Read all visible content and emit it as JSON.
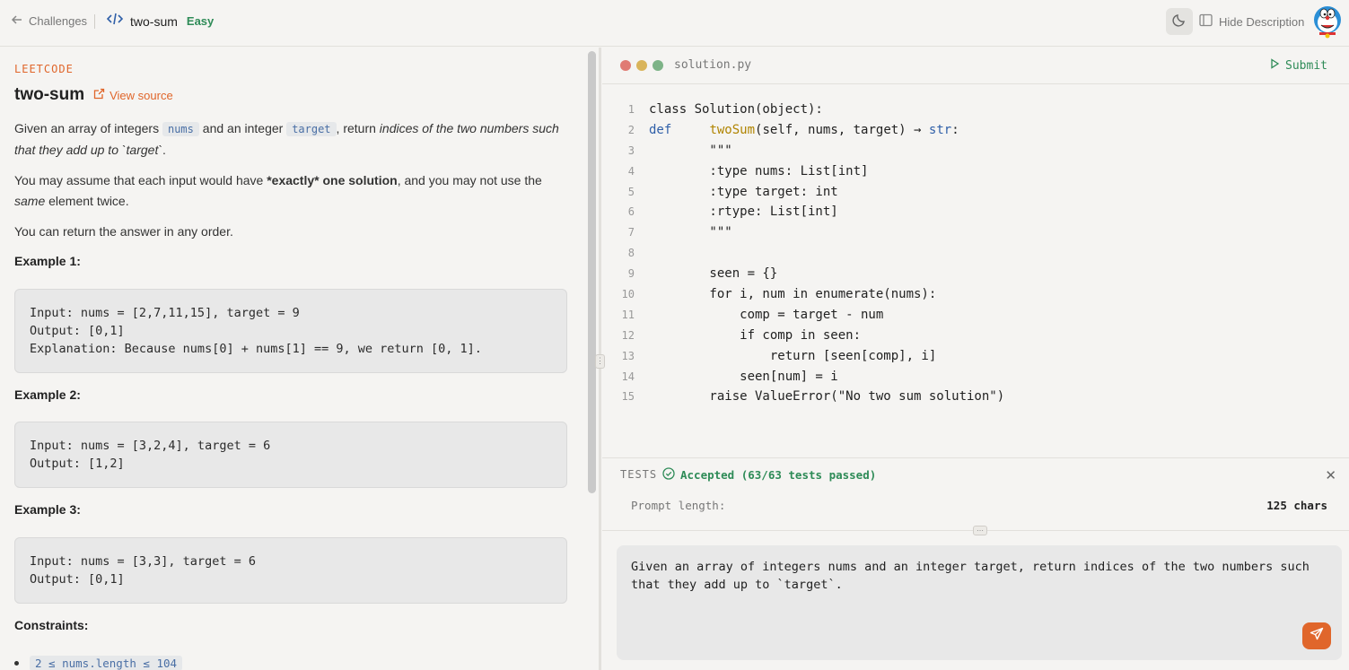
{
  "topbar": {
    "back_label": "Challenges",
    "title": "two-sum",
    "difficulty": "Easy",
    "hide_description_label": "Hide Description"
  },
  "problem": {
    "source": "LEETCODE",
    "title": "two-sum",
    "view_source": "View source",
    "p1_a": "Given an array of integers ",
    "p1_code1": "nums",
    "p1_b": " and an integer ",
    "p1_code2": "target",
    "p1_c": ", return ",
    "p1_em": "indices of the two numbers such that they add up to `target`",
    "p1_d": ".",
    "p2_a": "You may assume that each input would have ",
    "p2_strong": "*exactly* one solution",
    "p2_b": ", and you may not use the ",
    "p2_em": "same",
    "p2_c": " element twice.",
    "p3": "You can return the answer in any order.",
    "examples": [
      {
        "heading": "Example 1:",
        "lines": [
          "Input: nums = [2,7,11,15], target = 9",
          "Output: [0,1]",
          "Explanation: Because nums[0] + nums[1] == 9, we return [0, 1]."
        ]
      },
      {
        "heading": "Example 2:",
        "lines": [
          "Input: nums = [3,2,4], target = 6",
          "Output: [1,2]"
        ]
      },
      {
        "heading": "Example 3:",
        "lines": [
          "Input: nums = [3,3], target = 6",
          "Output: [0,1]"
        ]
      }
    ],
    "constraints_heading": "Constraints:",
    "constraint_1": "2 ≤ nums.length ≤ 104"
  },
  "editor": {
    "filename": "solution.py",
    "submit_label": "Submit",
    "lines": [
      {
        "n": "1"
      },
      {
        "n": "2"
      },
      {
        "n": "3"
      },
      {
        "n": "4"
      },
      {
        "n": "5"
      },
      {
        "n": "6"
      },
      {
        "n": "7"
      },
      {
        "n": "8"
      },
      {
        "n": "9"
      },
      {
        "n": "10"
      },
      {
        "n": "11"
      },
      {
        "n": "12"
      },
      {
        "n": "13"
      },
      {
        "n": "14"
      },
      {
        "n": "15"
      }
    ],
    "code": {
      "l1": "class Solution(object):",
      "l2_kw": "def",
      "l2_fn": "twoSum",
      "l2_mid": "(self, nums, target) → ",
      "l2_ret": "str",
      "l2_end": ":",
      "l3": "        \"\"\"",
      "l4": "        :type nums: List[int]",
      "l5": "        :type target: int",
      "l6": "        :rtype: List[int]",
      "l7": "        \"\"\"",
      "l8": "",
      "l9": "        seen = {}",
      "l10": "        for i, num in enumerate(nums):",
      "l11": "            comp = target - num",
      "l12": "            if comp in seen:",
      "l13": "                return [seen[comp], i]",
      "l14": "            seen[num] = i",
      "l15": "        raise ValueError(\"No two sum solution\")"
    }
  },
  "tests": {
    "label": "TESTS",
    "status": "Accepted (63/63 tests passed)",
    "prompt_length_label": "Prompt length:",
    "prompt_length_value": "125 chars"
  },
  "prompt": {
    "value": "Given an array of integers nums and an integer target, return indices of the two numbers such that they add up to `target`."
  },
  "colors": {
    "accent": "#e0662b",
    "success": "#2e8b57",
    "keyword": "#2f5fa8"
  }
}
